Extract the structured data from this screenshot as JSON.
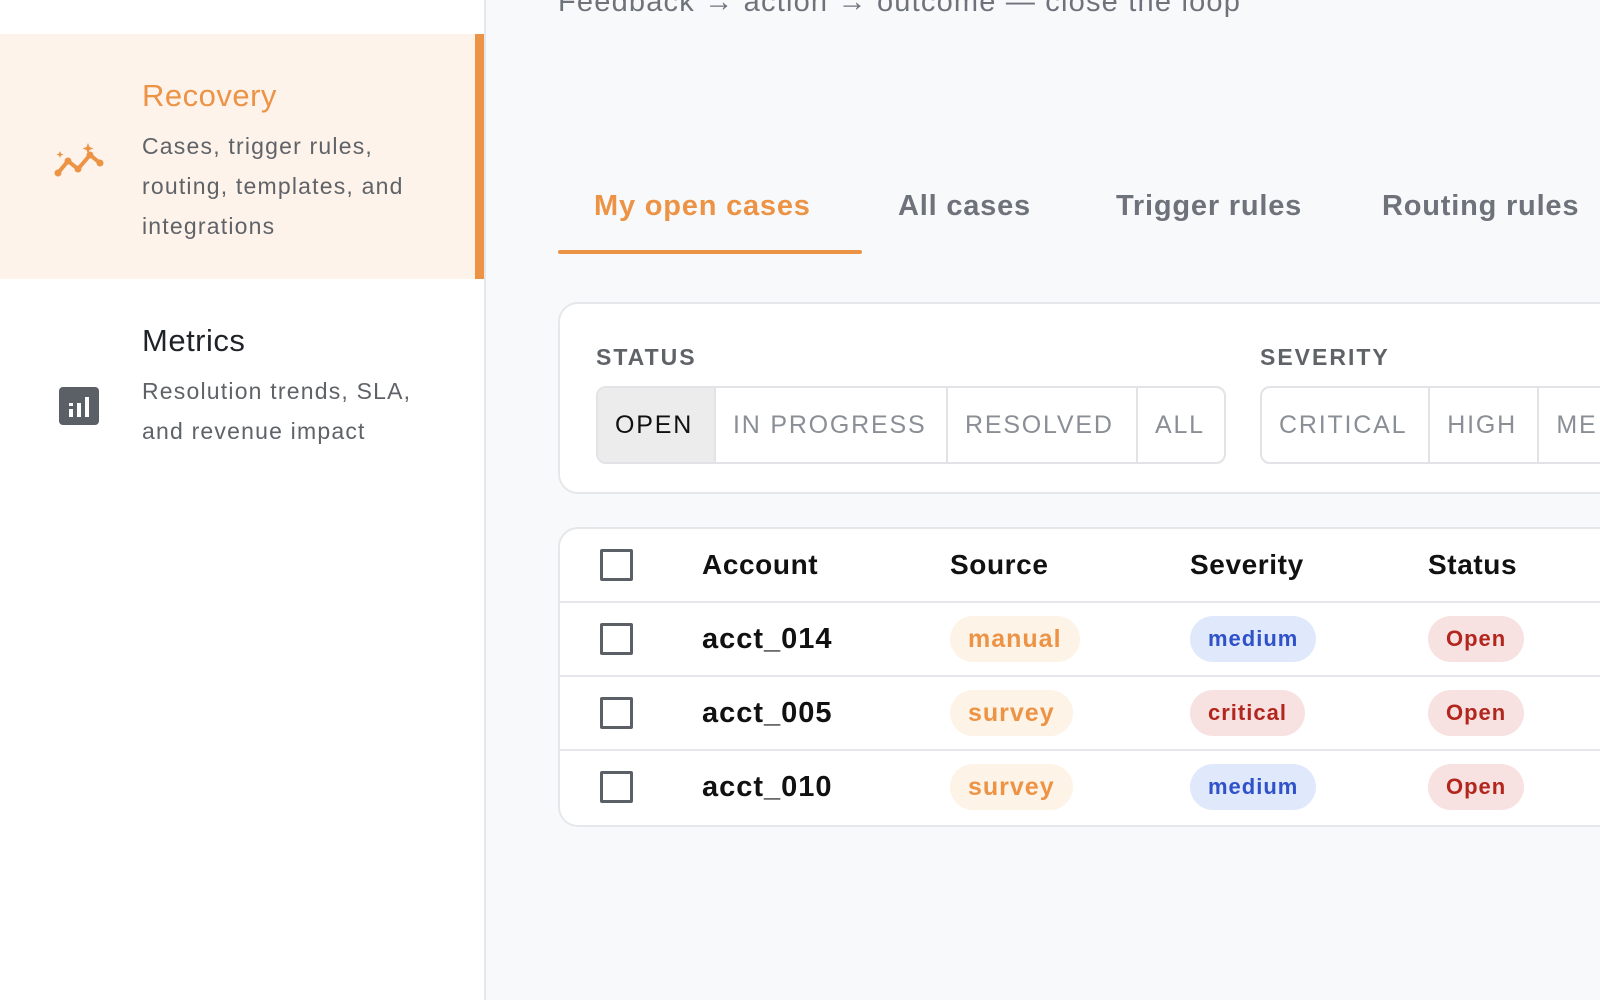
{
  "sidebar": {
    "items": [
      {
        "title": "Recovery",
        "description": "Cases, trigger rules, routing, templates, and integrations",
        "icon": "sparkle-trend-icon",
        "active": true
      },
      {
        "title": "Metrics",
        "description": "Resolution trends, SLA, and revenue impact",
        "icon": "bar-chart-icon",
        "active": false
      }
    ]
  },
  "header": {
    "subtitle": "Feedback → action → outcome — close the loop"
  },
  "tabs": [
    {
      "label": "My open cases",
      "active": true
    },
    {
      "label": "All cases",
      "active": false
    },
    {
      "label": "Trigger rules",
      "active": false
    },
    {
      "label": "Routing rules",
      "active": false
    }
  ],
  "filters": {
    "status": {
      "label": "STATUS",
      "options": [
        "OPEN",
        "IN PROGRESS",
        "RESOLVED",
        "ALL"
      ],
      "selected": "OPEN"
    },
    "severity": {
      "label": "SEVERITY",
      "options": [
        "CRITICAL",
        "HIGH",
        "ME"
      ]
    }
  },
  "table": {
    "columns": [
      "Account",
      "Source",
      "Severity",
      "Status"
    ],
    "rows": [
      {
        "account": "acct_014",
        "source": "manual",
        "severity": "medium",
        "status": "Open"
      },
      {
        "account": "acct_005",
        "source": "survey",
        "severity": "critical",
        "status": "Open"
      },
      {
        "account": "acct_010",
        "source": "survey",
        "severity": "medium",
        "status": "Open"
      }
    ]
  },
  "colors": {
    "accent": "#ec9346",
    "accent_bg": "#fdf3ea",
    "medium_bg": "#e0e9fb",
    "medium_fg": "#2f51c9",
    "critical_bg": "#f8e1e1",
    "critical_fg": "#b3261e"
  }
}
